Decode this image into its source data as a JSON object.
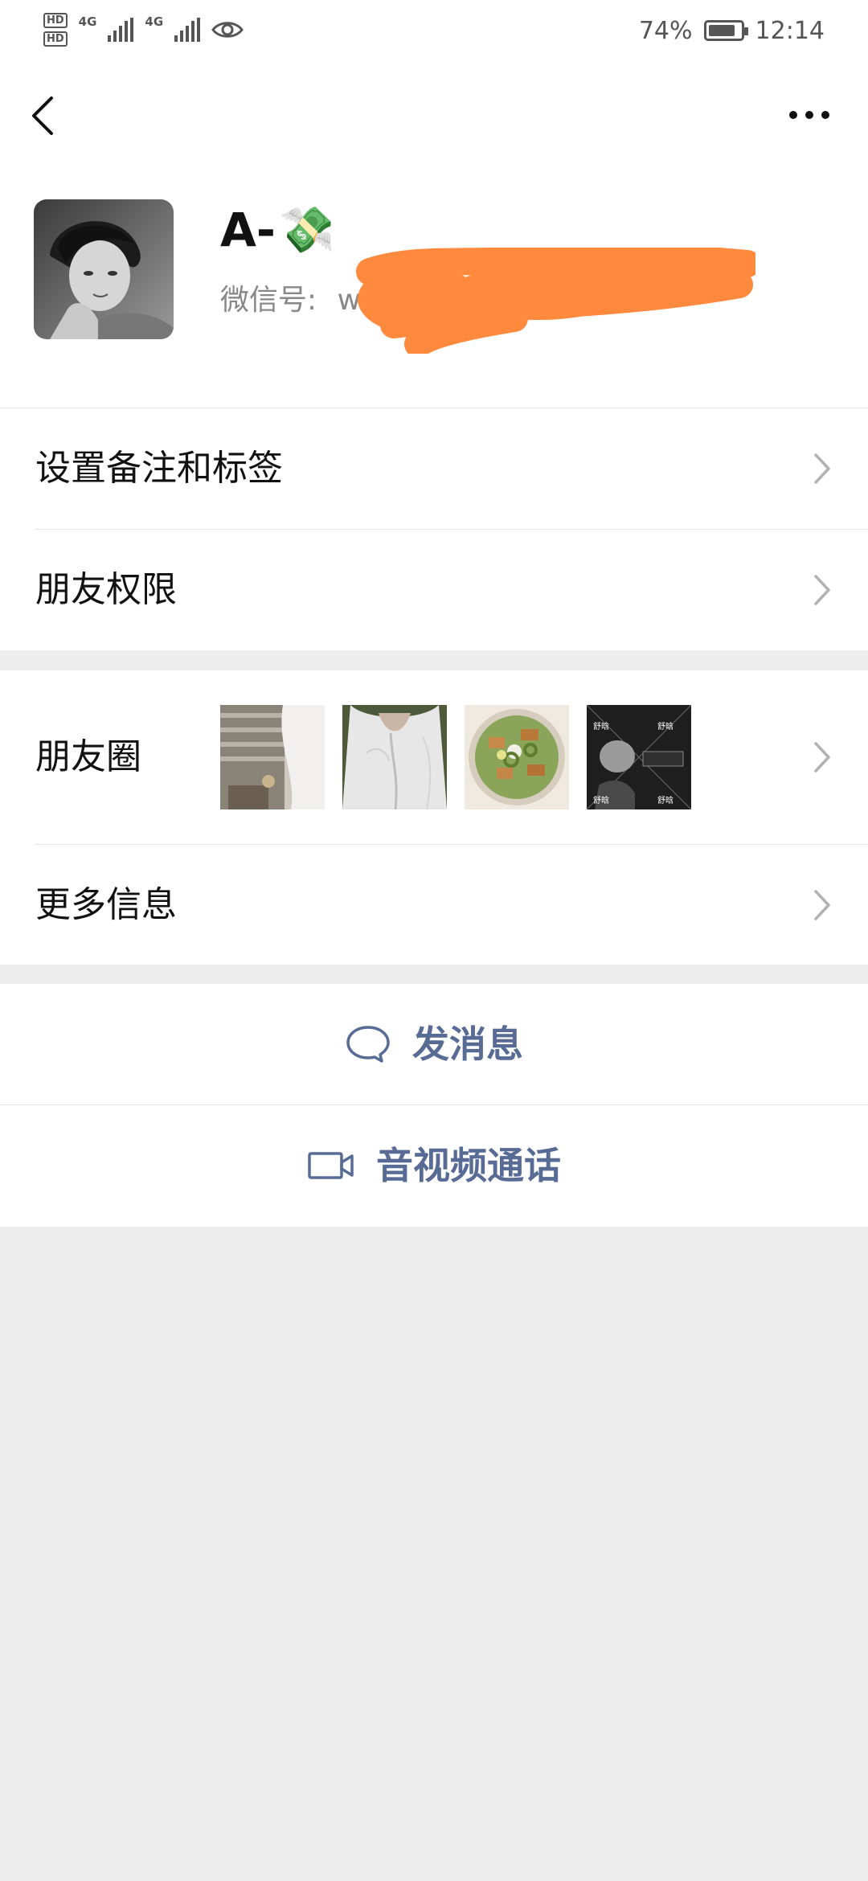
{
  "status_bar": {
    "hd_1": "HD",
    "hd_2": "HD",
    "net_1": "4G",
    "net_2": "4G",
    "battery_percent": "74%",
    "battery_level": 0.74,
    "time": "12:14",
    "icons": [
      "hd-icon",
      "signal-icon",
      "eye-icon",
      "battery-icon"
    ]
  },
  "nav": {
    "back_icon": "chevron-left-icon",
    "more_icon": "more-dots-icon"
  },
  "profile": {
    "name": "A-",
    "name_emoji": "💸",
    "wechat_id_label": "微信号:",
    "wechat_id_value": "w",
    "avatar_icon": "avatar",
    "redaction_color": "#ff8a3d"
  },
  "menu": {
    "remark_tags": "设置备注和标签",
    "friend_permissions": "朋友权限",
    "moments": "朋友圈",
    "more_info": "更多信息",
    "moment_thumb_captions": [
      "舒晗",
      "舒晗",
      "舒晗",
      "舒晗"
    ]
  },
  "actions": {
    "send_message": "发消息",
    "video_call": "音视频通话",
    "accent_color": "#576b95"
  }
}
